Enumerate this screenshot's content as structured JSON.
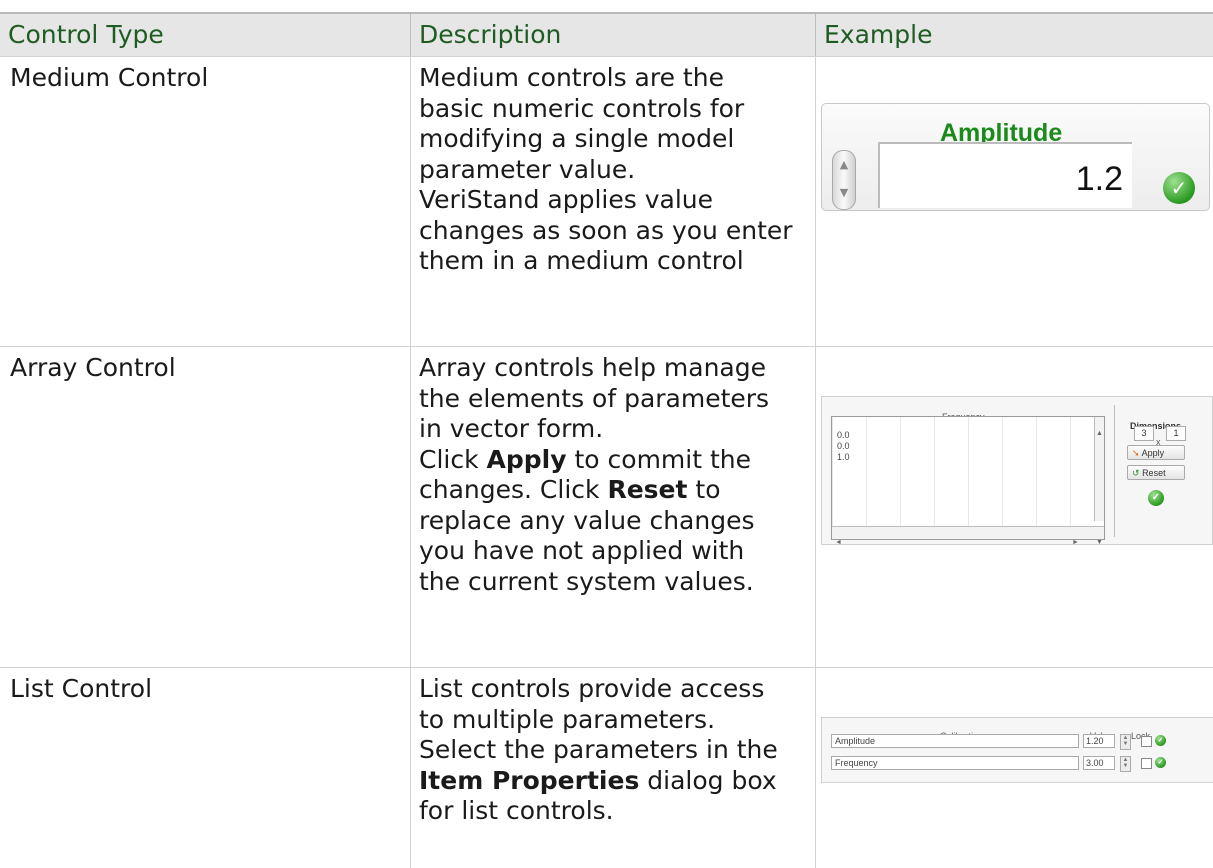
{
  "table": {
    "headers": [
      "Control Type",
      "Description",
      "Example"
    ],
    "rows": [
      {
        "type": "Medium Control",
        "desc": [
          "Medium controls are the",
          "basic numeric controls for",
          "modifying a single model",
          "parameter value.",
          "VeriStand applies value",
          "changes as soon as you enter",
          "them in a medium control"
        ]
      },
      {
        "type": "Array Control",
        "desc": {
          "l1": "Array controls help manage",
          "l2": "the elements of parameters",
          "l3": "in vector form.",
          "l4_pre": "Click ",
          "l4_bold": "Apply",
          "l4_post": " to commit the",
          "l5_pre": "changes. Click ",
          "l5_bold": "Reset",
          "l5_post": " to",
          "l6": "replace any value changes",
          "l7": "you have not applied with",
          "l8": "the current system values."
        }
      },
      {
        "type": "List Control",
        "desc": {
          "l1": "List controls provide access",
          "l2": "to multiple parameters.",
          "l3": "Select the parameters in the",
          "l4_bold": "Item Properties",
          "l4_post": " dialog box",
          "l5": "for list controls."
        }
      }
    ]
  },
  "examples": {
    "medium": {
      "title": "Amplitude",
      "value": "1.2",
      "status_icon": "check-circle-icon"
    },
    "array": {
      "title": "Frequency",
      "items": [
        "0.0",
        "0.0",
        "1.0"
      ],
      "dimensions_label": "Dimensions",
      "dim1": "3",
      "dim_sep": "x",
      "dim2": "1",
      "apply_label": "Apply",
      "reset_label": "Reset"
    },
    "list": {
      "header_name": "Calibration",
      "header_value": "Value",
      "header_lock": "Lock",
      "rows": [
        {
          "name": "Amplitude",
          "value": "1.20"
        },
        {
          "name": "Frequency",
          "value": "3.00"
        }
      ]
    }
  },
  "colors": {
    "header_text": "#1e5c22",
    "header_bg": "#e6e6e6",
    "check_green": "#2c9b22"
  }
}
